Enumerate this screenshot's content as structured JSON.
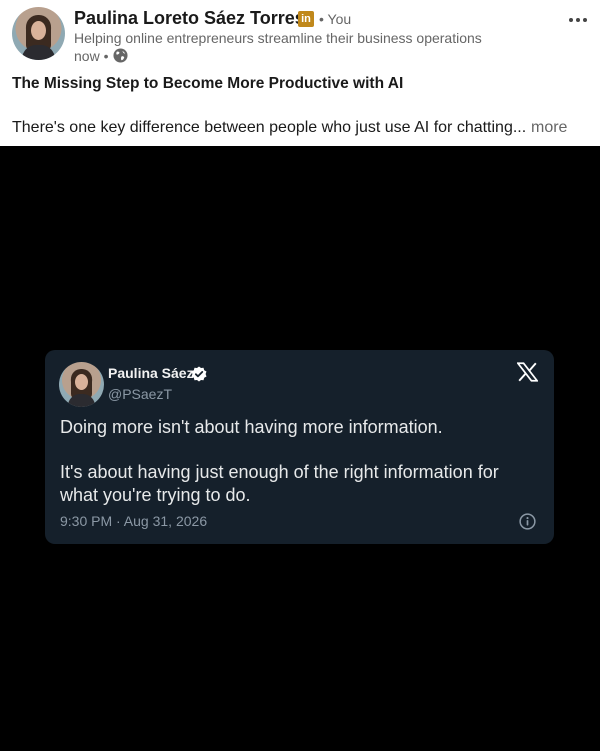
{
  "post": {
    "author_name": "Paulina Loreto Sáez Torres",
    "badge_icon": "linkedin-premium-icon",
    "badge_text": "in",
    "relation": "• You",
    "headline": "Helping online entrepreneurs streamline their business operations",
    "time": "now •",
    "visibility_icon": "globe-icon",
    "title": "The Missing Step to Become More Productive with AI",
    "body_preview": "There's one key difference between people who just use AI for chatting...",
    "see_more": "more",
    "menu_icon": "more-options-icon"
  },
  "tweet": {
    "name": "Paulina Sáez",
    "verified_icon": "verified-icon",
    "handle": "@PSaezT",
    "platform_icon": "x-logo-icon",
    "text_1": "Doing more isn't about having more information.",
    "text_2": "It's about having just enough of the right information for what you're trying to do.",
    "timestamp": "9:30 PM · Aug 31, 2026",
    "info_icon": "info-icon"
  },
  "colors": {
    "badge": "#c0881b",
    "media_background": "#000000",
    "tweet_card": "#15202b",
    "tweet_text": "#e7e9ea",
    "tweet_muted": "#8b98a5"
  }
}
